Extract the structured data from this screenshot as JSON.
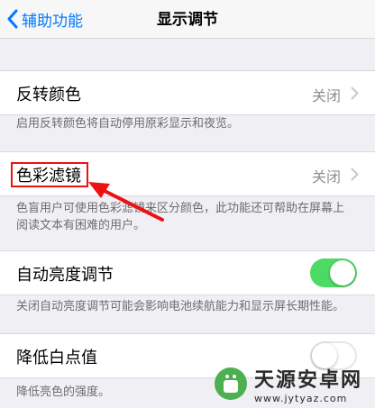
{
  "nav": {
    "back_label": "辅助功能",
    "title": "显示调节"
  },
  "rows": {
    "invert": {
      "label": "反转颜色",
      "value": "关闭",
      "footer": "启用反转颜色将自动停用原彩显示和夜览。"
    },
    "filters": {
      "label": "色彩滤镜",
      "value": "关闭",
      "footer_line1": "色盲用户可使用色彩滤镜来区分颜色，此功能还可帮助在屏幕上",
      "footer_line2": "阅读文本有困难的用户。"
    },
    "auto_brightness": {
      "label": "自动亮度调节",
      "state": "on",
      "footer": "关闭自动亮度调节可能会影响电池续航能力和显示屏长期性能。"
    },
    "reduce_white": {
      "label": "降低白点值",
      "state": "off",
      "footer": "降低亮色的强度。"
    }
  },
  "watermark": {
    "name": "天源安卓网",
    "url": "www.jytyaz.com"
  },
  "colors": {
    "accent": "#007aff",
    "toggle_on": "#4cd964",
    "annotation": "#ee1111"
  },
  "icons": {
    "back": "chevron-left-icon",
    "disclosure": "chevron-right-icon"
  }
}
